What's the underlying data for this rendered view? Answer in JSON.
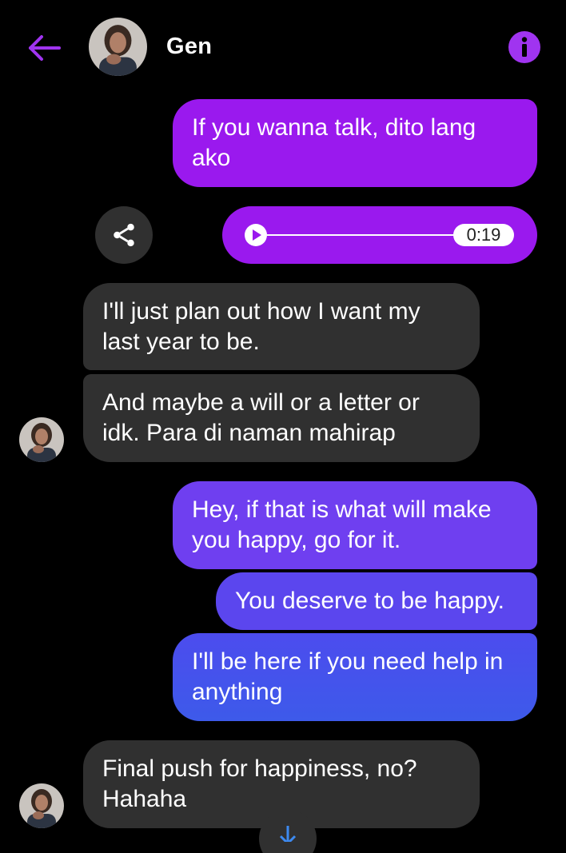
{
  "header": {
    "contact_name": "Gen",
    "back_icon": "arrow-left-icon",
    "info_icon": "info-icon",
    "accent_color": "#a034f0"
  },
  "messages": [
    {
      "direction": "outgoing",
      "text": "If you wanna talk, dito lang ako"
    },
    {
      "direction": "outgoing",
      "type": "voice",
      "duration": "0:19"
    },
    {
      "direction": "incoming",
      "text": "I'll just plan out how I want my last year to be."
    },
    {
      "direction": "incoming",
      "text": "And maybe a will or a letter or idk. Para di naman mahirap"
    },
    {
      "direction": "outgoing",
      "text": "Hey, if that is what will make you happy, go for it."
    },
    {
      "direction": "outgoing",
      "text": "You deserve to be happy."
    },
    {
      "direction": "outgoing",
      "text": "I'll be here if you need help in anything"
    },
    {
      "direction": "incoming",
      "text": "Final push for happiness, no? Hahaha"
    }
  ],
  "colors": {
    "incoming_bubble": "#303030",
    "outgoing_purple": "#9a19ee",
    "outgoing_violet": "#6f3ff0",
    "outgoing_blue": "#3d5aea",
    "background": "#000000"
  },
  "icons": {
    "share": "share-icon",
    "play": "play-icon",
    "scroll_down": "arrow-down-icon"
  }
}
